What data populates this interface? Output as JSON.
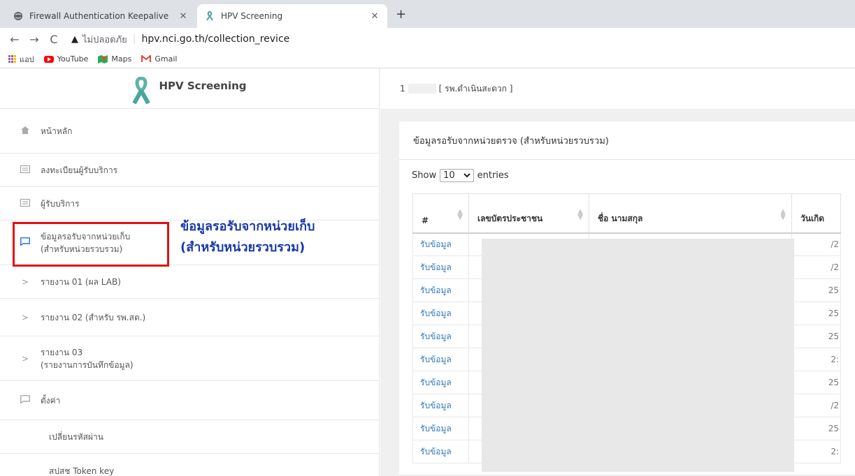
{
  "browser": {
    "tabs": [
      {
        "title": "Firewall Authentication Keepalive",
        "close": "✕"
      },
      {
        "title": "HPV Screening",
        "close": "✕"
      }
    ],
    "new_tab": "+",
    "not_secure": "ไม่ปลอดภัย",
    "url": "hpv.nci.go.th/collection_revice",
    "bookmarks": [
      "แอป",
      "YouTube",
      "Maps",
      "Gmail"
    ]
  },
  "app": {
    "brand": "HPV Screening",
    "header_prefix": "1",
    "header_hospital": "[ รพ.ดำเนินสะดวก ]"
  },
  "sidebar": {
    "items": [
      {
        "label": "หน้าหลัก",
        "icon": "home-icon"
      },
      {
        "label": "ลงทะเบียนผู้รับบริการ",
        "icon": "list-icon"
      },
      {
        "label": "ผู้รับบริการ",
        "icon": "list-icon"
      },
      {
        "label": "ข้อมูลรอรับจากหน่วยเก็บ",
        "label2": "(สำหรับหน่วยรวบรวม)",
        "icon": "chat-icon",
        "active": true
      },
      {
        "label": "รายงาน 01 (ผล LAB)",
        "icon": "chevron-right-icon"
      },
      {
        "label": "รายงาน 02 (สำหรับ รพ.สต.)",
        "icon": "chevron-right-icon"
      },
      {
        "label": "รายงาน 03",
        "label2": "(รายงานการบันทึกข้อมูล)",
        "icon": "chevron-right-icon"
      },
      {
        "label": "ตั้งค่า",
        "icon": "chat-icon"
      },
      {
        "label": "เปลี่ยนรหัสผ่าน",
        "icon": ""
      },
      {
        "label": "สปสช Token key",
        "icon": ""
      }
    ]
  },
  "annotation": {
    "line1": "ข้อมูลรอรับจากหน่วยเก็บ",
    "line2": "(สำหรับหน่วยรวบรวม)"
  },
  "card": {
    "title": "ข้อมูลรอรับจากหน่วยตรวจ (สำหรับหน่วยรวบรวม)",
    "show_label": "Show",
    "show_value": "10",
    "entries_label": "entries",
    "columns": [
      "#",
      "เลขบัตรประชาชน",
      "ชื่อ นามสกุล",
      "วันเกิด"
    ],
    "row_action": "รับข้อมูล",
    "dob_fragments": [
      "/2",
      "/2",
      "25",
      "25",
      "25",
      "2:",
      "25",
      "/2",
      "25",
      "2:"
    ]
  },
  "colors": {
    "link": "#337ab7",
    "highlight_border": "#e01010",
    "annotation_text": "#1a3aa8"
  }
}
